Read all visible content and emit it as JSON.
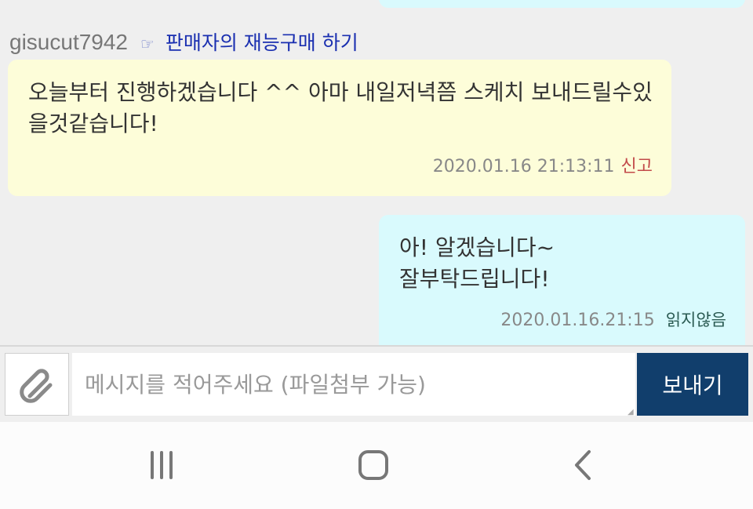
{
  "conversation": {
    "sender": {
      "name": "gisucut7942",
      "link_label": "판매자의 재능구매 하기",
      "link_icon": "pointing-hand-icon"
    },
    "messages": [
      {
        "direction": "incoming",
        "text": "오늘부터 진행하겠습니다 ^^ 아마 내일저녁쯤 스케치 보내드릴수있을것같습니다!",
        "timestamp": "2020.01.16 21:13:11",
        "report_label": "신고"
      },
      {
        "direction": "outgoing",
        "text": "아! 알겠습니다~\n잘부탁드립니다!",
        "timestamp": "2020.01.16.21:15",
        "status": "읽지않음"
      }
    ]
  },
  "composer": {
    "attach_icon": "paperclip-icon",
    "placeholder": "메시지를 적어주세요 (파일첨부 가능)",
    "value": "",
    "send_label": "보내기"
  },
  "navbar": {
    "buttons": [
      "recent-apps-icon",
      "home-icon",
      "back-icon"
    ]
  },
  "colors": {
    "incoming_bubble": "#fdfdd9",
    "outgoing_bubble": "#d9fafd",
    "send_button": "#113e6c",
    "link": "#1a2fb0",
    "report": "#c24a4a"
  }
}
